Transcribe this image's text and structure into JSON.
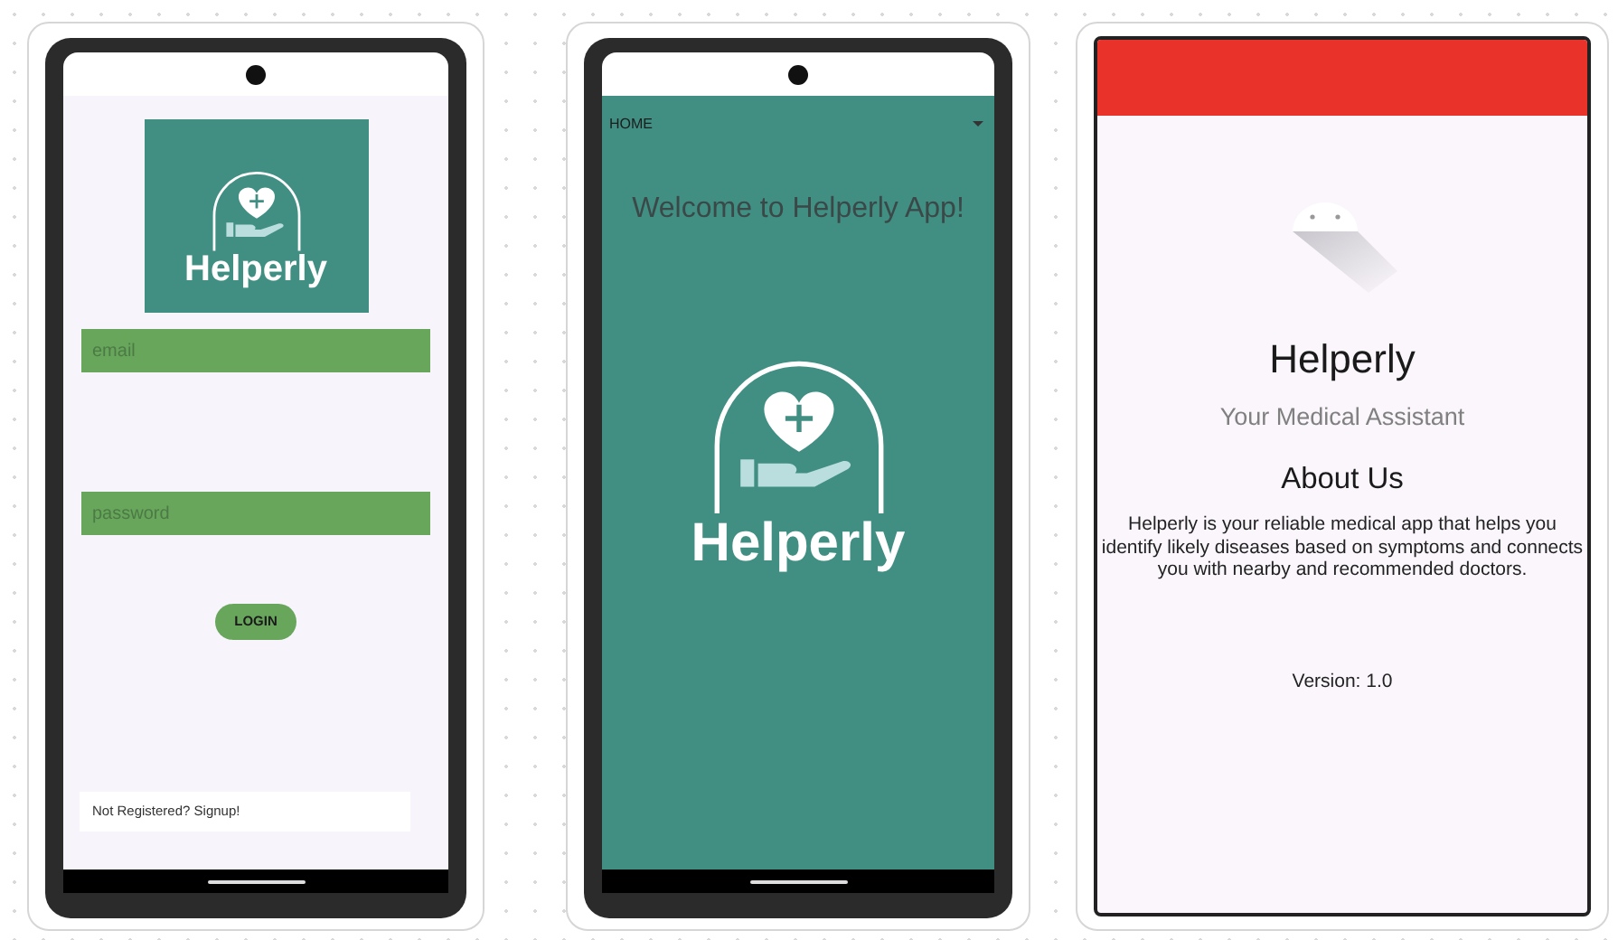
{
  "screens": [
    {
      "kind": "login",
      "logo_text": "Helperly",
      "fields": [
        {
          "placeholder": "email"
        },
        {
          "placeholder": "password"
        }
      ],
      "login_button": "LOGIN",
      "signup_link": "Not Registered? Signup!"
    },
    {
      "kind": "home",
      "menu_label": "HOME",
      "welcome": "Welcome to Helperly App!",
      "logo_text": "Helperly"
    },
    {
      "kind": "about",
      "app_name": "Helperly",
      "tagline": "Your Medical Assistant",
      "heading": "About Us",
      "description": "Helperly is your reliable medical app that helps you identify likely diseases based on symptoms and connects you with nearby and recommended doctors.",
      "version": "Version: 1.0"
    }
  ]
}
